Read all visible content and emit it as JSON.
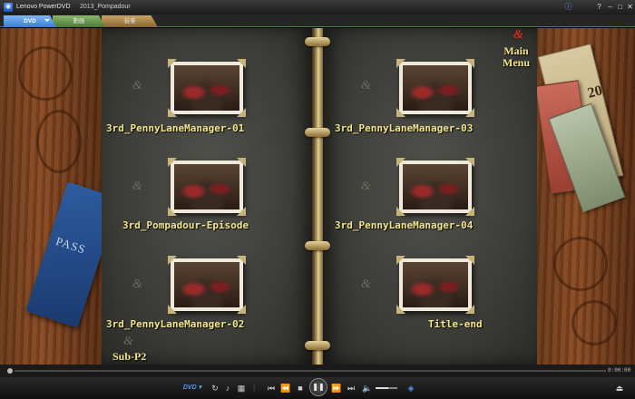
{
  "window": {
    "app_title": "Lenovo PowerDVD",
    "document_title": "2013_Pompadour",
    "time_display": "0:00:00"
  },
  "tabs": [
    {
      "label": "DVD",
      "active": true
    },
    {
      "label": "動画",
      "active": false
    },
    {
      "label": "音楽",
      "active": false
    }
  ],
  "menu": {
    "main_menu_label": "Main\nMenu",
    "sub_label": "Sub-P2",
    "passport_text": "PASS",
    "banknote_number": "20",
    "chapters": [
      {
        "label": "3rd_PennyLaneManager-01"
      },
      {
        "label": "3rd_Pompadour-Episode"
      },
      {
        "label": "3rd_PennyLaneManager-02"
      },
      {
        "label": "3rd_PennyLaneManager-03"
      },
      {
        "label": "3rd_PennyLaneManager-04"
      },
      {
        "label": "Title-end"
      }
    ]
  },
  "controls": {
    "dvd_label": "DVD",
    "volume_level": 0.6
  },
  "colors": {
    "label_yellow": "#f3e58a",
    "accent_blue": "#3a7fd2",
    "main_menu_ornament_red": "#d72a1c"
  }
}
